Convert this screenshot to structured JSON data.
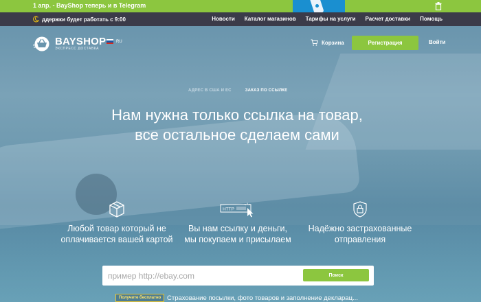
{
  "promo": {
    "text": "1 апр. - BayShop теперь и в Telegram",
    "trash_icon": "trash-icon"
  },
  "navbar": {
    "support_text": "ддержки будет работать с 9:00",
    "links": [
      "Новости",
      "Каталог магазинов",
      "Тарифы на услуги",
      "Расчет доставки",
      "Помощь"
    ]
  },
  "header": {
    "brand": "BAYSHOP",
    "tagline": "ЭКСПРЕСС ДОСТАВКА",
    "lang_code": "RU",
    "cart_label": "Корзина",
    "register_label": "Регистрация",
    "login_label": "Войти"
  },
  "tabs": {
    "address": "АДРЕС В США И ЕС",
    "by_link": "ЗАКАЗ ПО ССЫЛКЕ",
    "active": "by_link"
  },
  "headline": {
    "line1": "Нам нужна только ссылка на товар,",
    "line2": "все остальное сделаем сами"
  },
  "features": [
    {
      "icon": "package-icon",
      "line1": "Любой товар который не",
      "line2": "оплачивается вашей картой"
    },
    {
      "icon": "http-link-icon",
      "line1": "Вы нам ссылку и деньги,",
      "line2": "мы покупаем и присылаем"
    },
    {
      "icon": "padlock-shield-icon",
      "line1": "Надёжно застрахованные",
      "line2": "отправления"
    }
  ],
  "search": {
    "placeholder": "пример http://ebay.com",
    "button_label": "Поиск"
  },
  "bottom": {
    "badge": "Получите бесплатно",
    "text": "Страхование посылки, фото товаров и заполнение декларац..."
  },
  "colors": {
    "accent_green": "#8cc63f",
    "navbar_dark": "#3b3b49",
    "hero_blue": "#6a95ad"
  }
}
